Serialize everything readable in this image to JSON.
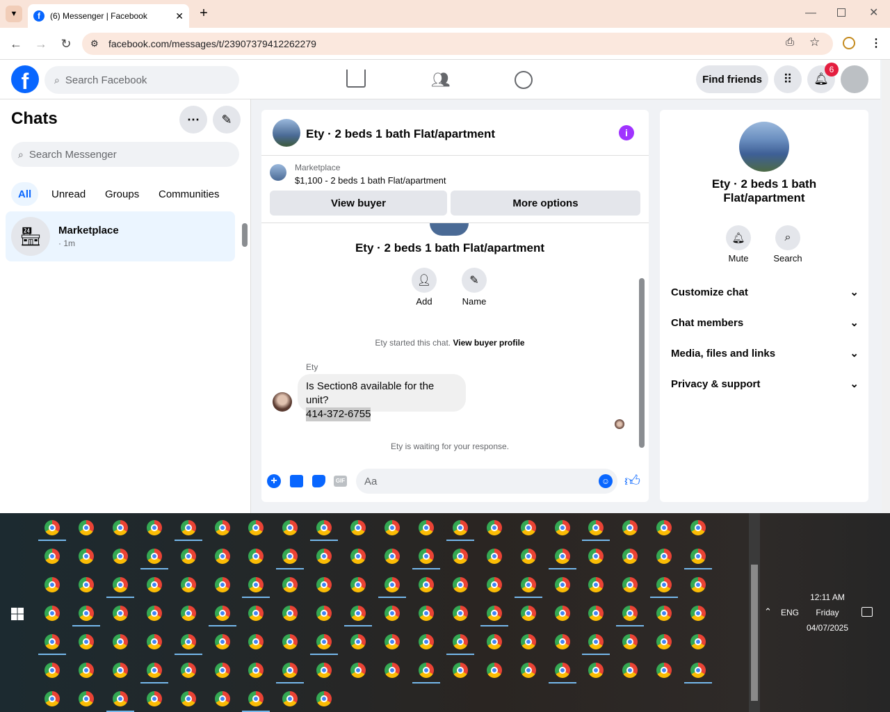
{
  "browser": {
    "tab_title": "(6) Messenger | Facebook",
    "url": "facebook.com/messages/t/23907379412262279"
  },
  "fb": {
    "search_placeholder": "Search Facebook",
    "find_friends": "Find friends",
    "notif_count": "6"
  },
  "left": {
    "title": "Chats",
    "search_placeholder": "Search Messenger",
    "filters": [
      "All",
      "Unread",
      "Groups",
      "Communities"
    ],
    "chat": {
      "name": "Marketplace",
      "time": "· 1m"
    }
  },
  "conv": {
    "title": "Ety · 2 beds 1 bath Flat/apartment",
    "listing_label": "Marketplace",
    "listing_text": "$1,100 - 2 beds 1 bath Flat/apartment",
    "view_buyer": "View buyer",
    "more_options": "More options",
    "profile_name": "Ety · 2 beds 1 bath Flat/apartment",
    "add_label": "Add",
    "name_label": "Name",
    "started_text": "Ety started this chat.",
    "view_profile_link": "View buyer profile",
    "sender": "Ety",
    "message_line1": "Is Section8 available for the unit?",
    "message_line2": "414-372-6755",
    "waiting": "Ety is waiting for your response.",
    "composer_placeholder": "Aa"
  },
  "right": {
    "name": "Ety · 2 beds 1 bath Flat/apartment",
    "mute": "Mute",
    "search": "Search",
    "rows": [
      "Customize chat",
      "Chat members",
      "Media, files and links",
      "Privacy & support"
    ]
  },
  "taskbar": {
    "time": "12:11 AM",
    "day": "Friday",
    "date": "04/07/2025",
    "lang": "ENG"
  },
  "colors": {
    "fb_blue": "#0866ff",
    "messenger_purple": "#a033ff",
    "badge_red": "#e41e3f"
  }
}
